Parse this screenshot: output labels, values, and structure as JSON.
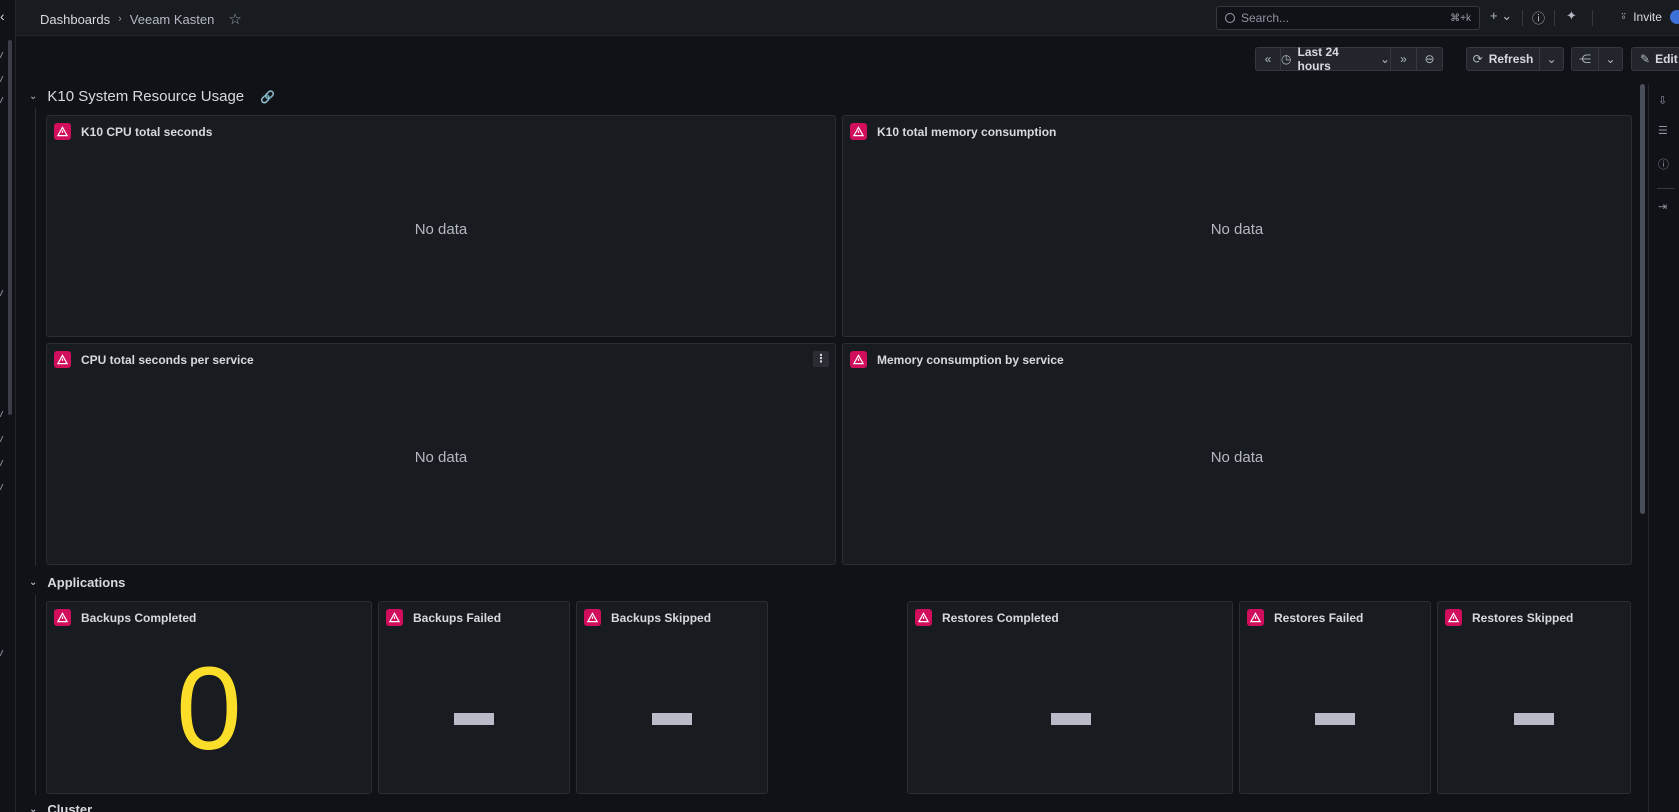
{
  "topbar": {
    "breadcrumb_root": "Dashboards",
    "breadcrumb_sep": "›",
    "breadcrumb_current": "Veeam Kasten",
    "search_placeholder": "Search...",
    "search_shortcut": "⌘+k",
    "invite_label": "Invite"
  },
  "toolbar": {
    "time_range": "Last 24 hours",
    "refresh_label": "Refresh",
    "edit_label": "Edit"
  },
  "rows": {
    "system": {
      "title": "K10 System Resource Usage"
    },
    "applications": {
      "title": "Applications"
    },
    "cluster": {
      "title": "Cluster"
    }
  },
  "panels": {
    "cpu_total": {
      "title": "K10 CPU total seconds",
      "message": "No data"
    },
    "mem_total": {
      "title": "K10 total memory consumption",
      "message": "No data"
    },
    "cpu_per_service": {
      "title": "CPU total seconds per service",
      "message": "No data"
    },
    "mem_per_service": {
      "title": "Memory consumption by service",
      "message": "No data"
    },
    "backups_completed": {
      "title": "Backups Completed",
      "value": "0"
    },
    "backups_failed": {
      "title": "Backups Failed"
    },
    "backups_skipped": {
      "title": "Backups Skipped"
    },
    "restores_completed": {
      "title": "Restores Completed"
    },
    "restores_failed": {
      "title": "Restores Failed"
    },
    "restores_skipped": {
      "title": "Restores Skipped"
    }
  },
  "colors": {
    "error_badge": "#d10e5c",
    "stat_value": "#fade2a",
    "background": "#111217",
    "panel": "#181b1f"
  }
}
